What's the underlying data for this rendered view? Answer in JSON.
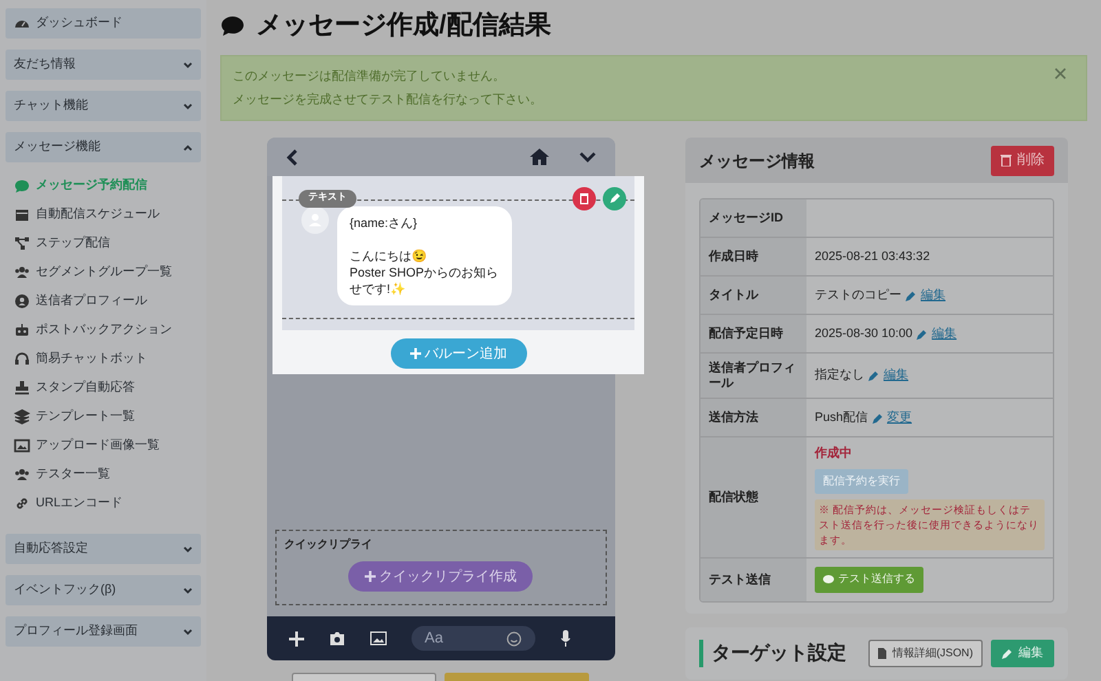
{
  "sidebar": {
    "items": [
      {
        "kind": "top",
        "label": "ダッシュボード"
      },
      {
        "kind": "section",
        "label": "友だち情報",
        "expanded": false
      },
      {
        "kind": "section",
        "label": "チャット機能",
        "expanded": false
      },
      {
        "kind": "section",
        "label": "メッセージ機能",
        "expanded": true
      },
      {
        "kind": "link",
        "label": "メッセージ予約配信",
        "selected": true
      },
      {
        "kind": "link",
        "label": "自動配信スケジュール",
        "selected": false
      },
      {
        "kind": "link",
        "label": "ステップ配信",
        "selected": false
      },
      {
        "kind": "link",
        "label": "セグメントグループ一覧",
        "selected": false
      },
      {
        "kind": "link",
        "label": "送信者プロフィール",
        "selected": false
      },
      {
        "kind": "link",
        "label": "ポストバックアクション",
        "selected": false
      },
      {
        "kind": "link",
        "label": "簡易チャットボット",
        "selected": false
      },
      {
        "kind": "link",
        "label": "スタンプ自動応答",
        "selected": false
      },
      {
        "kind": "link",
        "label": "テンプレート一覧",
        "selected": false
      },
      {
        "kind": "link",
        "label": "アップロード画像一覧",
        "selected": false
      },
      {
        "kind": "link",
        "label": "テスター一覧",
        "selected": false
      },
      {
        "kind": "link",
        "label": "URLエンコード",
        "selected": false
      },
      {
        "kind": "section",
        "label": "自動応答設定",
        "expanded": false
      },
      {
        "kind": "section",
        "label": "イベントフック(β)",
        "expanded": false
      },
      {
        "kind": "section",
        "label": "プロフィール登録画面",
        "expanded": false
      }
    ]
  },
  "page_title": "メッセージ作成/配信結果",
  "alert": {
    "lines": [
      "このメッセージは配信準備が完了していません。",
      "メッセージを完成させてテスト配信を行なって下さい。"
    ]
  },
  "preview": {
    "tag": "テキスト",
    "bubble": "{name:さん}\n\nこんにちは😉\nPoster SHOPからのお知らせです!✨",
    "add_button": "バルーン追加",
    "quick_reply": {
      "label": "クイックリプライ",
      "button": "クイックリプライ作成"
    },
    "input_placeholder": "Aa"
  },
  "message_info": {
    "title": "メッセージ情報",
    "delete": "削除",
    "rows": [
      {
        "kind": "text",
        "label": "メッセージID"
      },
      {
        "kind": "text",
        "label": "作成日時",
        "value": "2025-08-21 03:43:32"
      },
      {
        "kind": "link",
        "label": "タイトル",
        "value": "テストのコピー",
        "link": "編集"
      },
      {
        "kind": "link",
        "label": "配信予定日時",
        "value": "2025-08-30 10:00",
        "link": "編集"
      },
      {
        "kind": "link",
        "label": "送信者プロフィール",
        "value": "指定なし",
        "link": "編集"
      },
      {
        "kind": "link",
        "label": "送信方法",
        "value": "Push配信",
        "link": "変更"
      },
      {
        "kind": "status",
        "label": "配信状態",
        "status": "作成中",
        "button": "配信予約を実行",
        "disabled": true,
        "note": "※ 配信予約は、メッセージ検証もしくはテスト送信を行った後に使用できるようになります。"
      },
      {
        "kind": "button",
        "label": "テスト送信",
        "button": "テスト送信する"
      }
    ]
  },
  "target": {
    "title": "ターゲット設定",
    "json_button": "情報詳細(JSON)",
    "edit_button": "編集"
  }
}
